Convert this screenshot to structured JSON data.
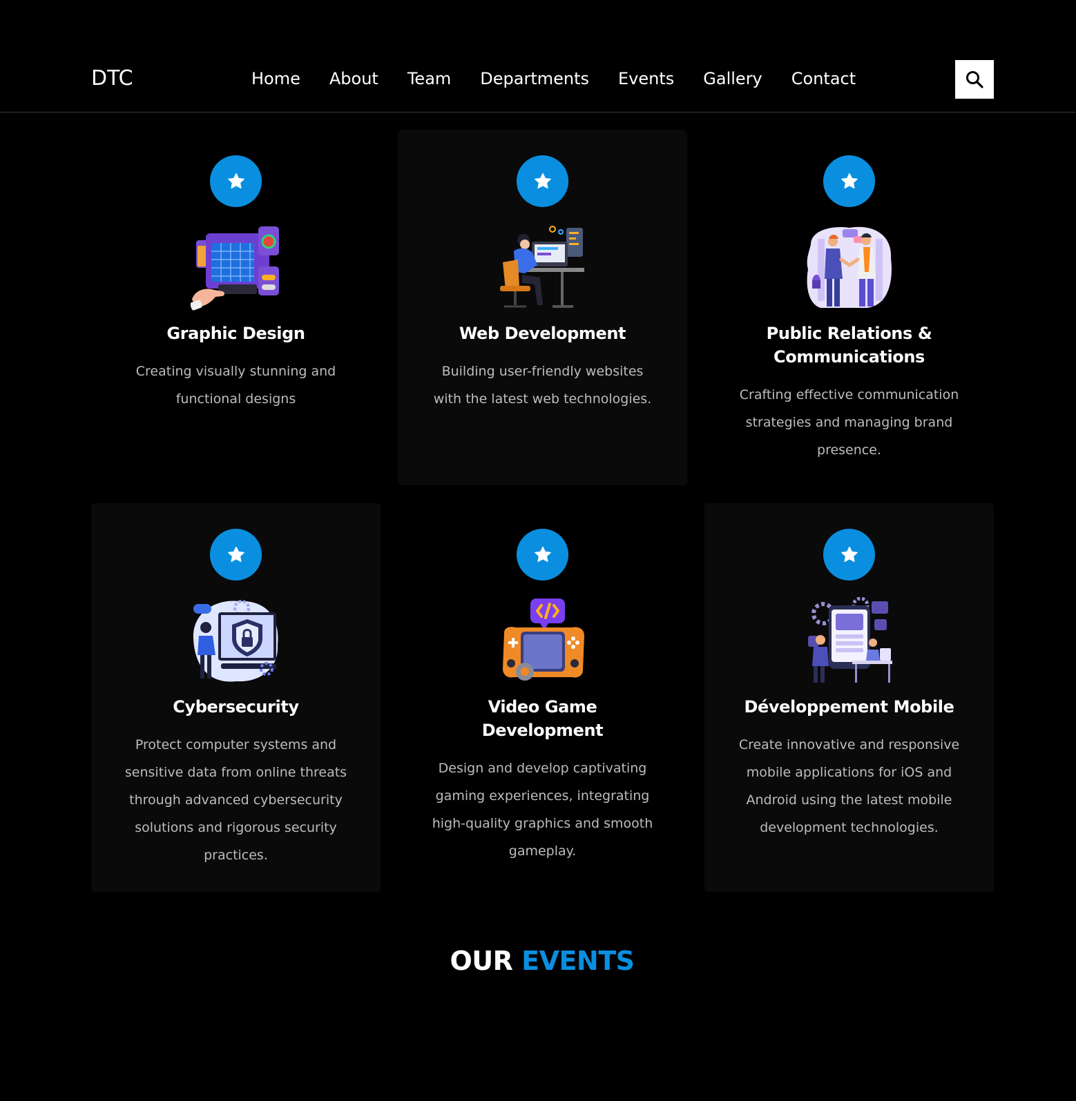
{
  "brand": {
    "name": "DTC"
  },
  "nav": {
    "items": [
      "Home",
      "About",
      "Team",
      "Departments",
      "Events",
      "Gallery",
      "Contact"
    ]
  },
  "search": {
    "icon": "search-icon"
  },
  "colors": {
    "background": "#000000",
    "card_background": "#0a0a0a",
    "accent": "#0a8fe0",
    "muted_text": "#bdbdbd"
  },
  "departments": [
    {
      "title": "Graphic Design",
      "description": "Creating visually stunning and functional designs",
      "icon": "star-icon",
      "illustration": "graphic-design-illustration"
    },
    {
      "title": "Web Development",
      "description": "Building user-friendly websites with the latest web technologies.",
      "icon": "star-icon",
      "illustration": "web-development-illustration"
    },
    {
      "title": "Public Relations & Communications",
      "description": "Crafting effective communication strategies and managing brand presence.",
      "icon": "star-icon",
      "illustration": "public-relations-illustration"
    },
    {
      "title": "Cybersecurity",
      "description": "Protect computer systems and sensitive data from online threats through advanced cybersecurity solutions and rigorous security practices.",
      "icon": "star-icon",
      "illustration": "cybersecurity-illustration"
    },
    {
      "title": "Video Game Development",
      "description": "Design and develop captivating gaming experiences, integrating high-quality graphics and smooth gameplay.",
      "icon": "star-icon",
      "illustration": "video-game-illustration"
    },
    {
      "title": "Développement Mobile",
      "description": "Create innovative and responsive mobile applications for iOS and Android using the latest mobile development technologies.",
      "icon": "star-icon",
      "illustration": "mobile-development-illustration"
    }
  ],
  "events_section": {
    "title_plain": "OUR",
    "title_accent": "EVENTS"
  }
}
